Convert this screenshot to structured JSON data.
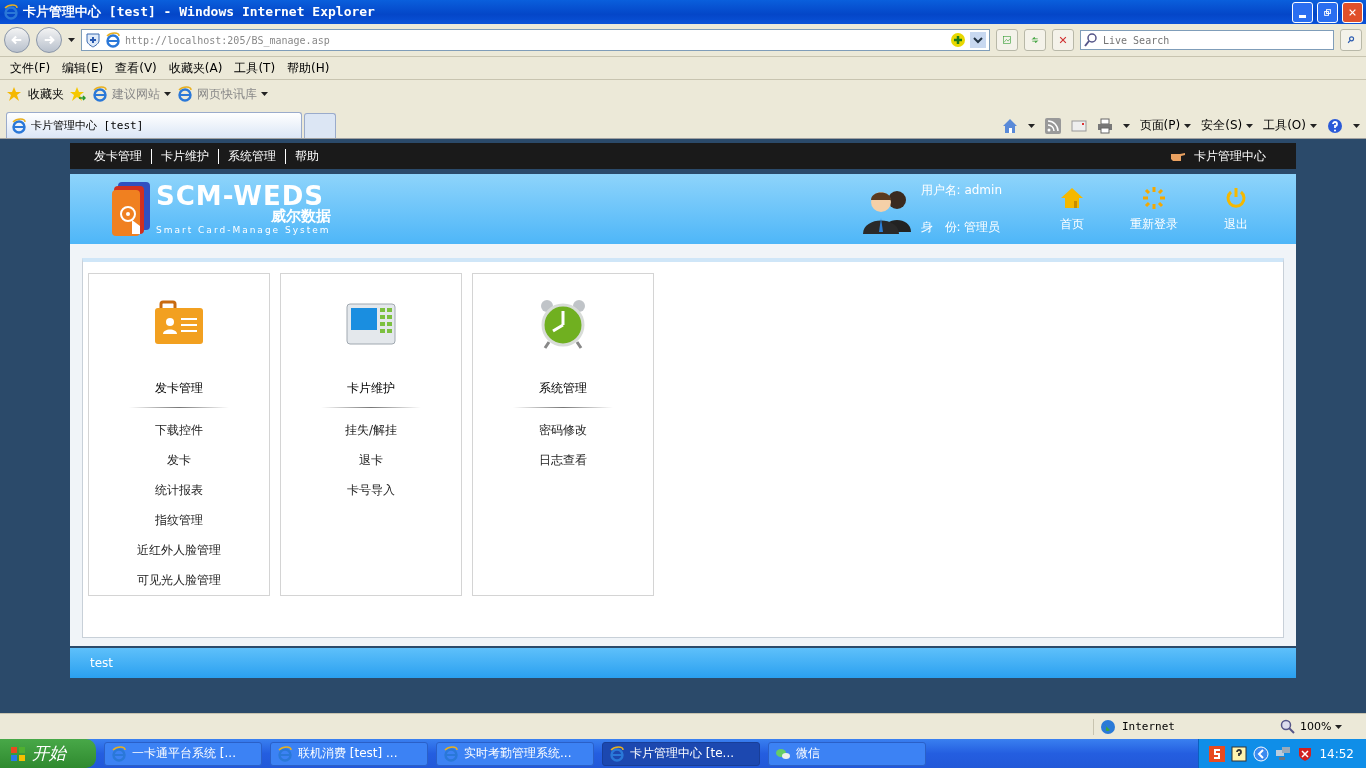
{
  "window": {
    "title": "卡片管理中心 [test] - Windows Internet Explorer"
  },
  "address_bar": {
    "url": "http://localhost:205/BS_manage.asp",
    "search_placeholder": "Live Search"
  },
  "menu": [
    "文件(F)",
    "编辑(E)",
    "查看(V)",
    "收藏夹(A)",
    "工具(T)",
    "帮助(H)"
  ],
  "favorites_bar": {
    "favorites": "收藏夹",
    "links": [
      "建议网站",
      "网页快讯库"
    ]
  },
  "tabs": [
    {
      "label": "卡片管理中心 [test]",
      "selected": true
    }
  ],
  "command_bar": [
    "页面(P)",
    "安全(S)",
    "工具(O)"
  ],
  "page": {
    "nav": [
      "发卡管理",
      "卡片维护",
      "系统管理",
      "帮助"
    ],
    "nav_right": "卡片管理中心",
    "logo": {
      "main": "SCM-WEDS",
      "sub_cn": "威尔数据",
      "sub_en": "Smart Card-Manage System"
    },
    "user": {
      "username": "用户名: admin",
      "role": "身　份: 管理员"
    },
    "actions": [
      {
        "kind": "home",
        "label": "首页"
      },
      {
        "kind": "relogin",
        "label": "重新登录"
      },
      {
        "kind": "exit",
        "label": "退出"
      }
    ],
    "cards": [
      {
        "kind": "id-card",
        "title": "发卡管理",
        "links": [
          "下载控件",
          "发卡",
          "统计报表",
          "指纹管理",
          "近红外人脸管理",
          "可见光人脸管理"
        ]
      },
      {
        "kind": "terminal",
        "title": "卡片维护",
        "links": [
          "挂失/解挂",
          "退卡",
          "卡号导入"
        ]
      },
      {
        "kind": "clock",
        "title": "系统管理",
        "links": [
          "密码修改",
          "日志查看"
        ]
      }
    ],
    "footer": "test"
  },
  "status_bar": {
    "zone": "Internet",
    "zoom": "100%"
  },
  "taskbar": {
    "start": "开始",
    "tasks": [
      {
        "label": "一卡通平台系统 [...",
        "selected": false
      },
      {
        "label": "联机消费 [test] ...",
        "selected": false
      },
      {
        "label": "实时考勤管理系统...",
        "selected": false
      },
      {
        "label": "卡片管理中心 [te...",
        "selected": true
      },
      {
        "label": "微信",
        "selected": false
      }
    ],
    "clock": "14:52"
  }
}
